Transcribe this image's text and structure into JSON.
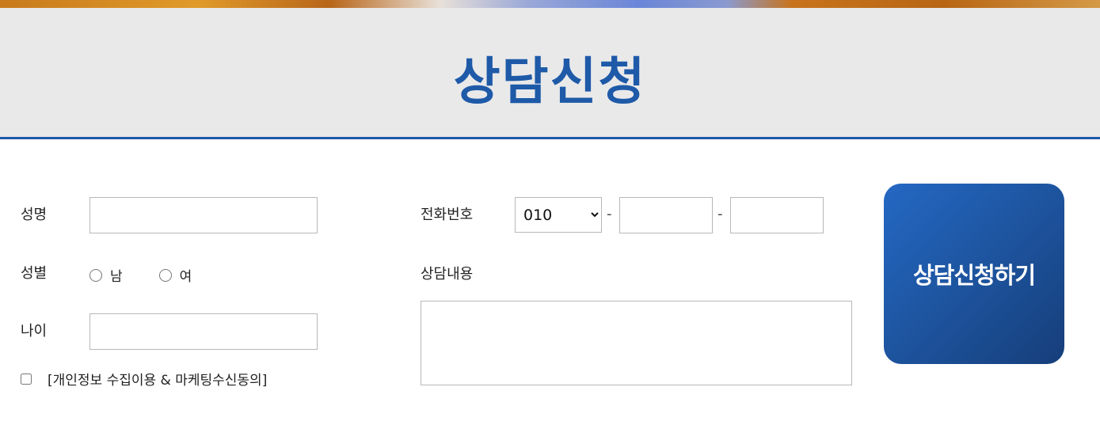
{
  "header": {
    "title": "상담신청"
  },
  "form": {
    "name": {
      "label": "성명",
      "value": ""
    },
    "gender": {
      "label": "성별",
      "options": [
        "남",
        "여"
      ],
      "selected": null
    },
    "age": {
      "label": "나이",
      "value": ""
    },
    "privacy_agreement": {
      "label": "[개인정보 수집이용 & 마케팅수신동의]",
      "checked": false
    },
    "phone": {
      "label": "전화번호",
      "prefix_selected": "010",
      "separator": "-",
      "middle": "",
      "last": ""
    },
    "consultation": {
      "label": "상담내용",
      "value": ""
    },
    "submit_label": "상담신청하기"
  },
  "colors": {
    "brand_blue": "#1e5aa8",
    "header_bg": "#e9e9ea",
    "button_gradient_start": "#2468c4",
    "button_gradient_end": "#163e7a"
  }
}
